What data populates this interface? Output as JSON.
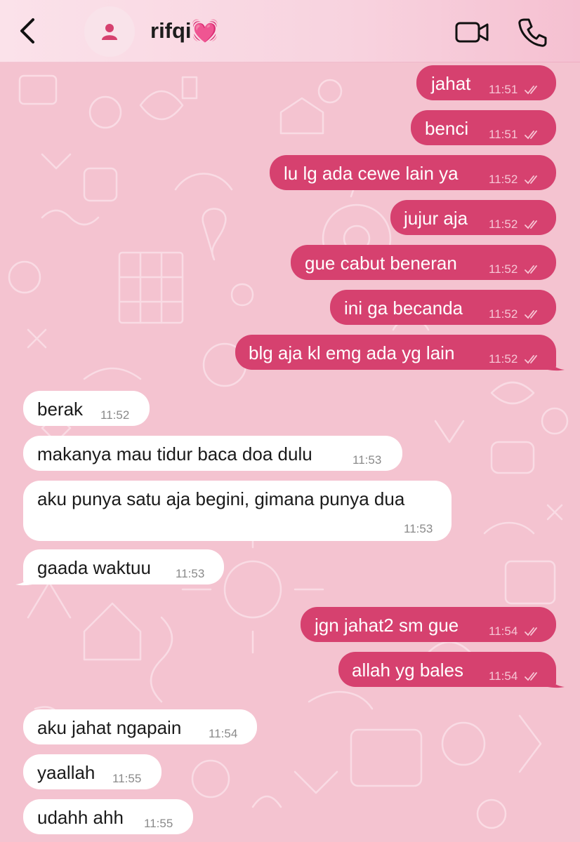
{
  "header": {
    "contact_name": "rifqi",
    "heart_emoji": "💓",
    "back_icon": "chevron-left-icon",
    "avatar_icon": "person-icon",
    "video_icon": "video-camera-icon",
    "call_icon": "phone-icon"
  },
  "colors": {
    "background": "#f4c3d0",
    "outgoing_bubble": "#d6416f",
    "incoming_bubble": "#ffffff",
    "header_gradient_start": "#fbe2ea",
    "header_gradient_end": "#f5c0d1"
  },
  "messages": [
    {
      "direction": "outgoing",
      "text": "jahat",
      "time": "11:51",
      "status": "read"
    },
    {
      "direction": "outgoing",
      "text": "benci",
      "time": "11:51",
      "status": "read"
    },
    {
      "direction": "outgoing",
      "text": "lu lg ada cewe lain ya",
      "time": "11:52",
      "status": "read"
    },
    {
      "direction": "outgoing",
      "text": "jujur aja",
      "time": "11:52",
      "status": "read"
    },
    {
      "direction": "outgoing",
      "text": "gue cabut beneran",
      "time": "11:52",
      "status": "read"
    },
    {
      "direction": "outgoing",
      "text": "ini ga becanda",
      "time": "11:52",
      "status": "read"
    },
    {
      "direction": "outgoing",
      "text": "blg aja kl emg ada yg lain",
      "time": "11:52",
      "status": "read"
    },
    {
      "direction": "incoming",
      "text": "berak",
      "time": "11:52"
    },
    {
      "direction": "incoming",
      "text": "makanya mau tidur baca doa dulu",
      "time": "11:53"
    },
    {
      "direction": "incoming",
      "text": "aku punya satu aja begini, gimana punya dua",
      "time": "11:53"
    },
    {
      "direction": "incoming",
      "text": "gaada waktuu",
      "time": "11:53"
    },
    {
      "direction": "outgoing",
      "text": "jgn jahat2 sm gue",
      "time": "11:54",
      "status": "read"
    },
    {
      "direction": "outgoing",
      "text": "allah yg bales",
      "time": "11:54",
      "status": "read"
    },
    {
      "direction": "incoming",
      "text": "aku jahat ngapain",
      "time": "11:54"
    },
    {
      "direction": "incoming",
      "text": "yaallah",
      "time": "11:55"
    },
    {
      "direction": "incoming",
      "text": "udahh ahh",
      "time": "11:55"
    }
  ]
}
